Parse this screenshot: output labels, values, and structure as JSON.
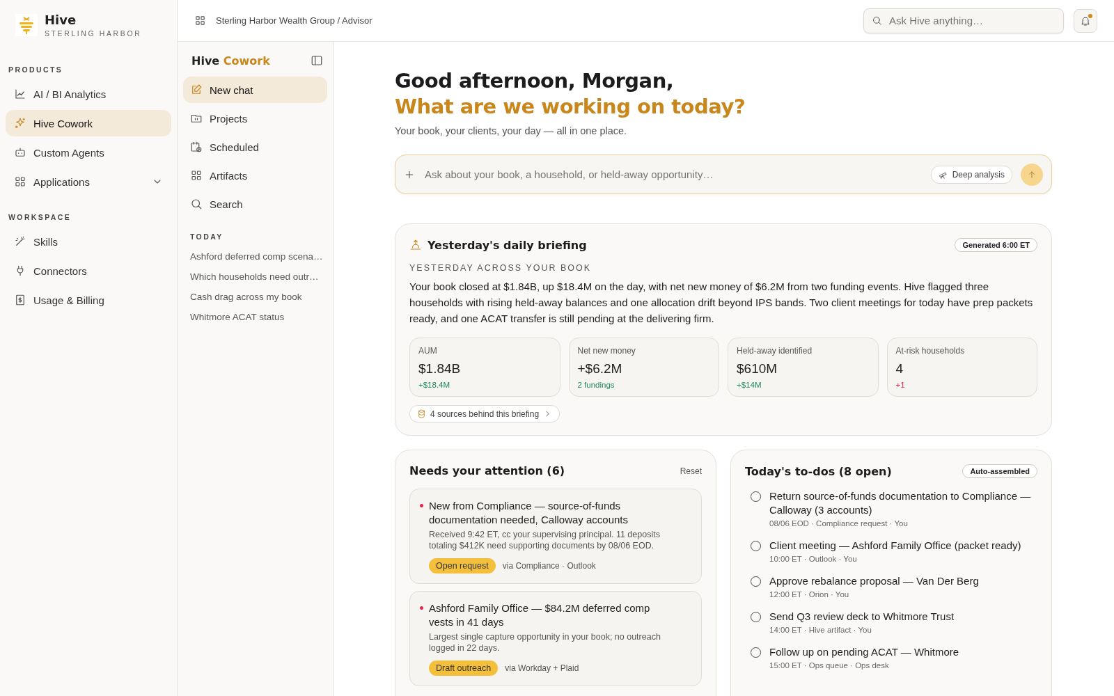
{
  "app": {
    "name": "Hive",
    "org": "STERLING HARBOR"
  },
  "sidebar": {
    "sections": [
      {
        "heading": "PRODUCTS",
        "items": [
          {
            "label": "AI / BI Analytics",
            "kind": "link",
            "selected": false
          },
          {
            "label": "Hive Cowork",
            "kind": "link",
            "selected": true
          },
          {
            "label": "Custom Agents",
            "kind": "link",
            "selected": false
          },
          {
            "label": "Applications",
            "kind": "group",
            "selected": false
          }
        ]
      },
      {
        "heading": "WORKSPACE",
        "items": [
          {
            "label": "Skills",
            "kind": "link",
            "selected": false
          },
          {
            "label": "Connectors",
            "kind": "link",
            "selected": false
          },
          {
            "label": "Usage & Billing",
            "kind": "link",
            "selected": false
          }
        ]
      }
    ]
  },
  "topbar": {
    "breadcrumb": "Sterling Harbor Wealth Group / Advisor",
    "search": {
      "placeholder": "Ask Hive anything…"
    },
    "notifications": {
      "unread": true
    }
  },
  "cowork_panel": {
    "brand": "Hive",
    "product": "Cowork",
    "nav": [
      {
        "label": "New chat",
        "selected": true
      },
      {
        "label": "Projects",
        "selected": false
      },
      {
        "label": "Scheduled",
        "selected": false
      },
      {
        "label": "Artifacts",
        "selected": false
      },
      {
        "label": "Search",
        "selected": false
      }
    ],
    "history_heading": "TODAY",
    "history": [
      "Ashford deferred comp scena…",
      "Which households need outr…",
      "Cash drag across my book",
      "Whitmore ACAT status"
    ]
  },
  "greeting": {
    "line1": "Good afternoon, Morgan,",
    "line2": "What are we working on today?",
    "subtitle": "Your book, your clients, your day — all in one place."
  },
  "composer": {
    "placeholder": "Ask about your book, a household, or held-away opportunity…",
    "mode": "Deep analysis"
  },
  "briefing": {
    "title": "Yesterday's daily briefing",
    "badge": "Generated 6:00 ET",
    "eyebrow": "YESTERDAY ACROSS YOUR BOOK",
    "summary": "Your book closed at $1.84B, up $18.4M on the day, with net new money of $6.2M from two funding events. Hive flagged three households with rising held-away balances and one allocation drift beyond IPS bands. Two client meetings for today have prep packets ready, and one ACAT transfer is still pending at the delivering firm.",
    "metrics": [
      {
        "label": "AUM",
        "value": "$1.84B",
        "delta": "+$18.4M",
        "color": "#1a8a5a"
      },
      {
        "label": "Net new money",
        "value": "+$6.2M",
        "delta": "2 fundings",
        "color": "#1a8a5a"
      },
      {
        "label": "Held-away identified",
        "value": "$610M",
        "delta": "+$14M",
        "color": "#1a8a5a"
      },
      {
        "label": "At-risk households",
        "value": "4",
        "delta": "+1",
        "color": "#e8254f"
      }
    ],
    "sources": "4 sources behind this briefing"
  },
  "attention": {
    "title": "Needs your attention (6)",
    "action": "Reset",
    "items": [
      {
        "title": "New from Compliance — source-of-funds documentation needed, Calloway accounts",
        "detail": "Received 9:42 ET, cc your supervising principal. 11 deposits totaling $412K need supporting documents by 08/06 EOD.",
        "action": "Open request",
        "source": "via Compliance · Outlook",
        "color": "#e8254f"
      },
      {
        "title": "Ashford Family Office — $84.2M deferred comp vests in 41 days",
        "detail": "Largest single capture opportunity in your book; no outreach logged in 22 days.",
        "action": "Draft outreach",
        "source": "via Workday + Plaid",
        "color": "#e8254f"
      }
    ]
  },
  "todos": {
    "title": "Today's to-dos (8 open)",
    "badge": "Auto-assembled",
    "items": [
      {
        "title": "Return source-of-funds documentation to Compliance — Calloway (3 accounts)",
        "meta": "08/06 EOD · Compliance request · You",
        "checked": false
      },
      {
        "title": "Client meeting — Ashford Family Office (packet ready)",
        "meta": "10:00 ET · Outlook · You",
        "checked": false
      },
      {
        "title": "Approve rebalance proposal — Van Der Berg",
        "meta": "12:00 ET · Orion · You",
        "checked": false
      },
      {
        "title": "Send Q3 review deck to Whitmore Trust",
        "meta": "14:00 ET · Hive artifact · You",
        "checked": false
      },
      {
        "title": "Follow up on pending ACAT — Whitmore",
        "meta": "15:00 ET · Ops queue · Ops desk",
        "checked": false
      }
    ]
  }
}
